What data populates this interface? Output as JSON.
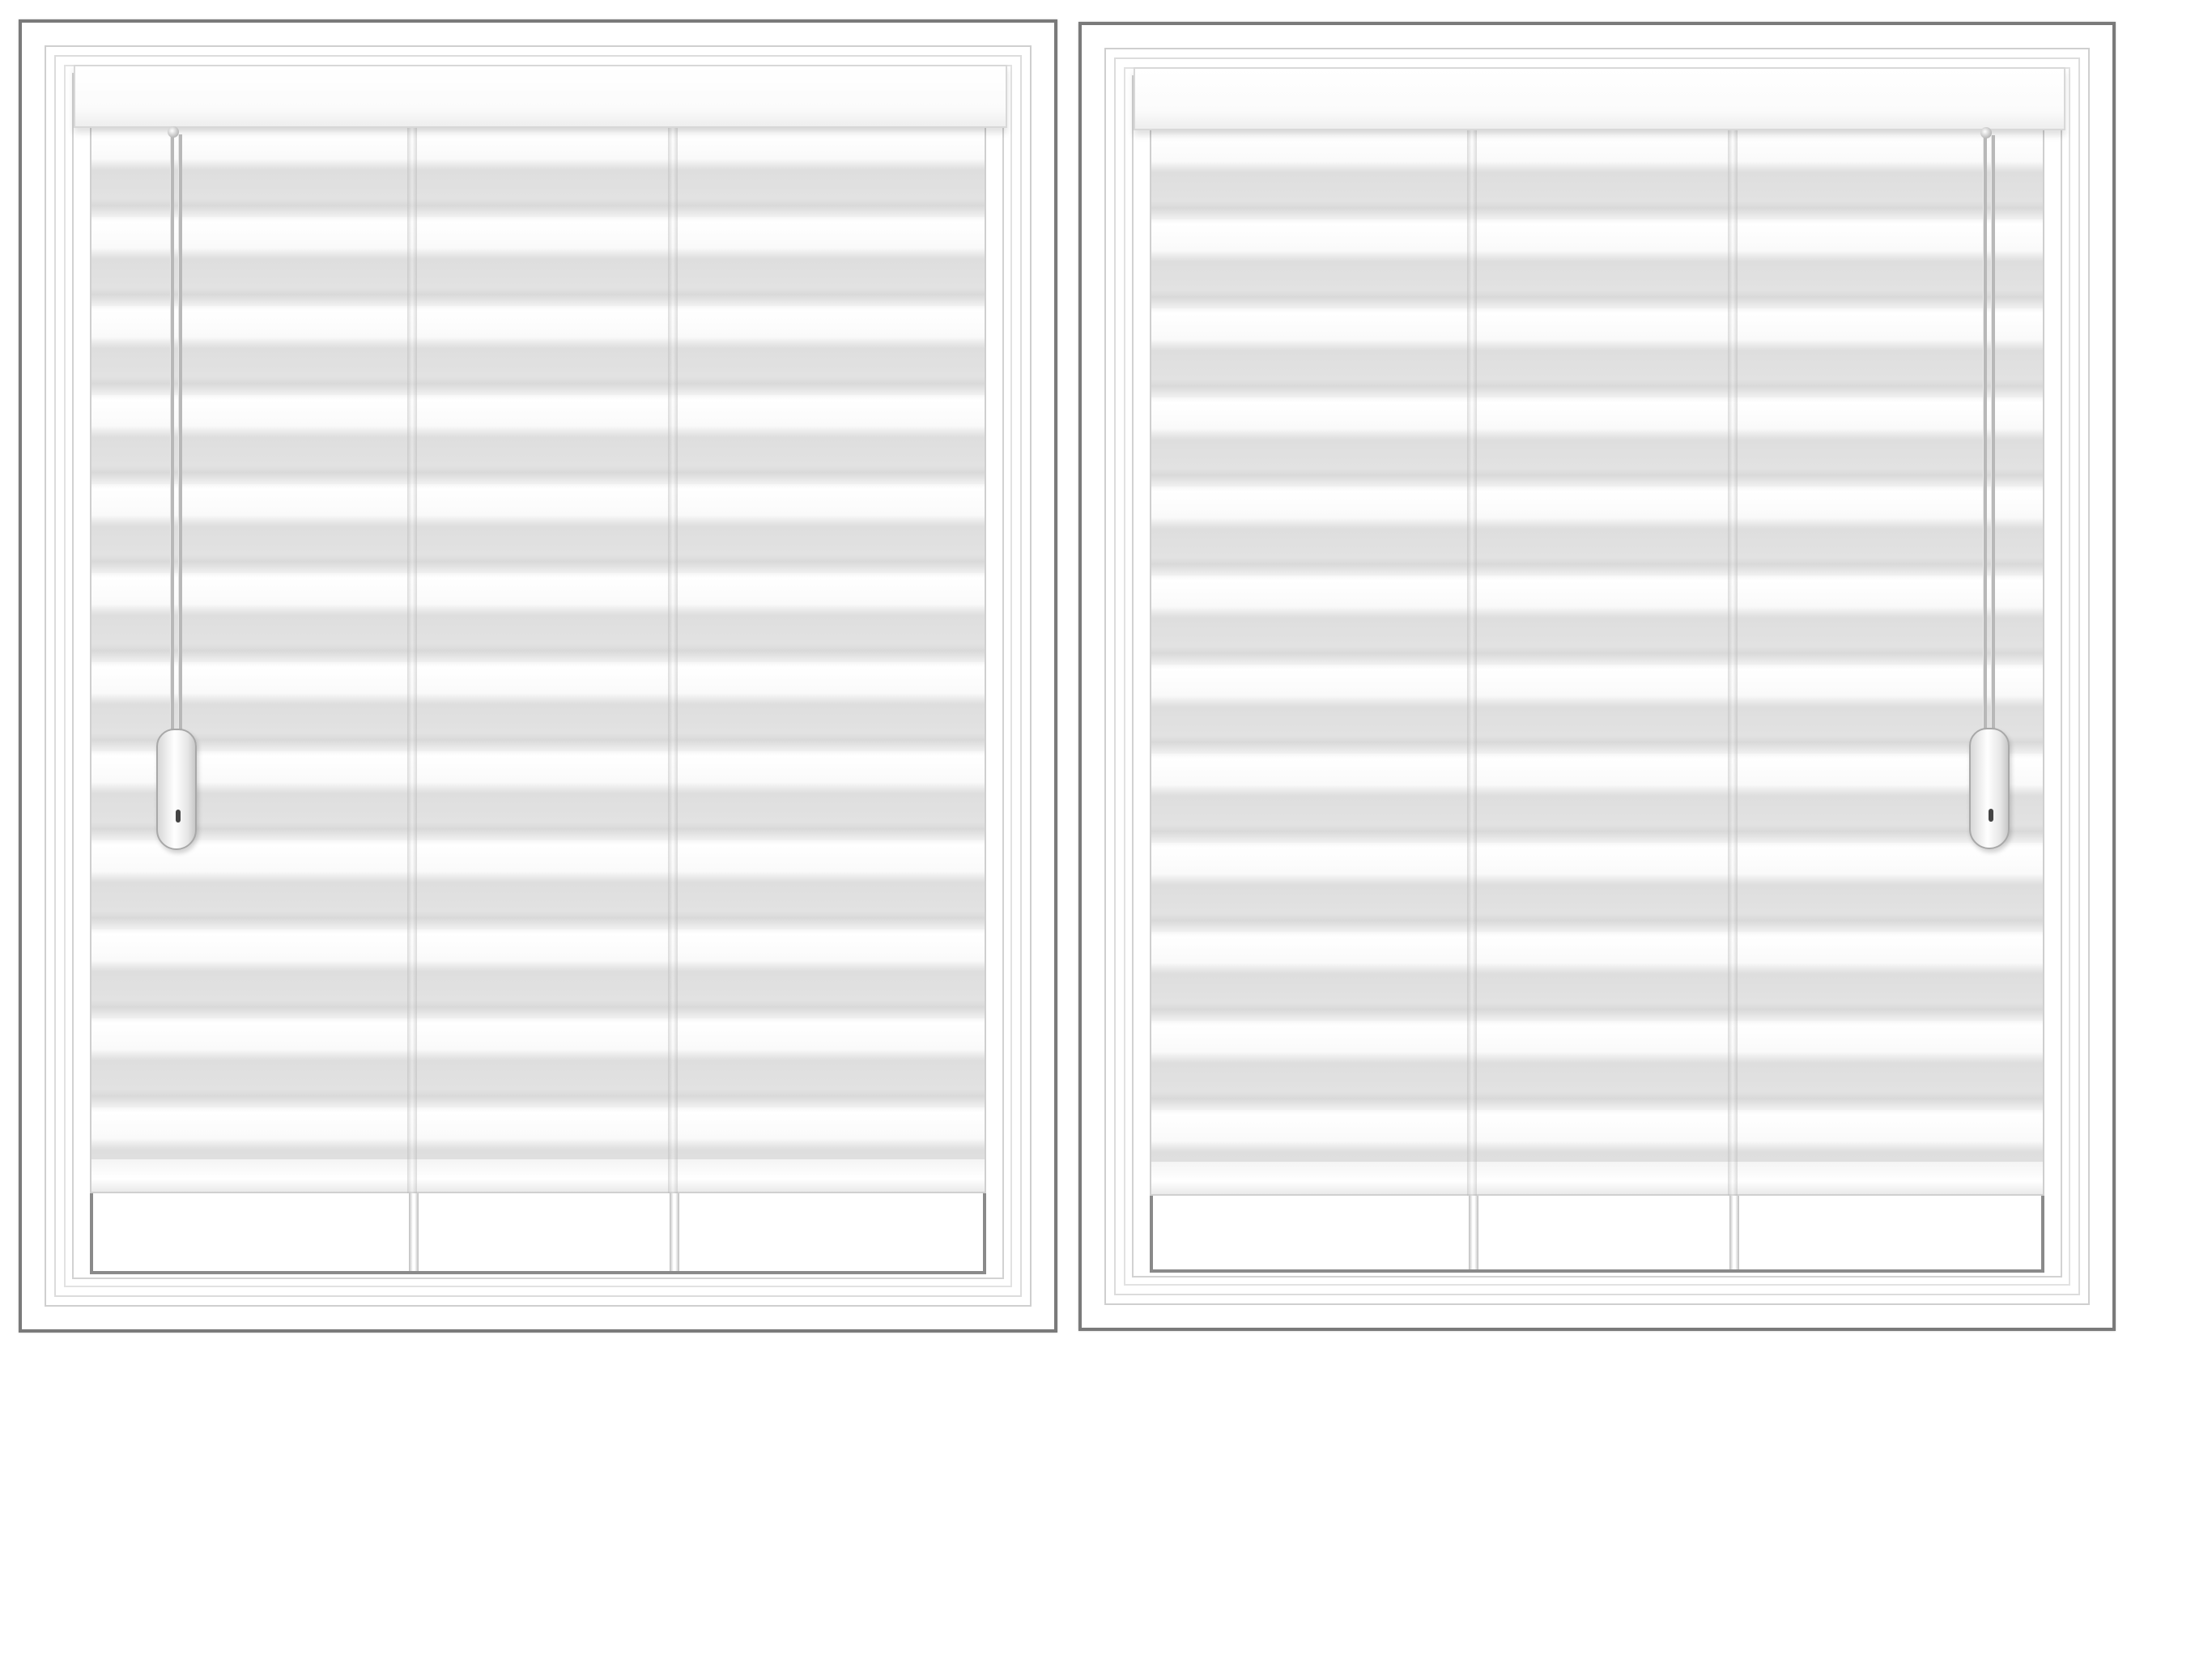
{
  "scene": {
    "colors": {
      "frame": "#7a7a7a",
      "fabric_light": "#ffffff",
      "fabric_dark": "#dedede",
      "background": "#ffffff"
    },
    "windows": [
      {
        "id": "left",
        "cord_side": "left"
      },
      {
        "id": "right",
        "cord_side": "right"
      }
    ]
  }
}
